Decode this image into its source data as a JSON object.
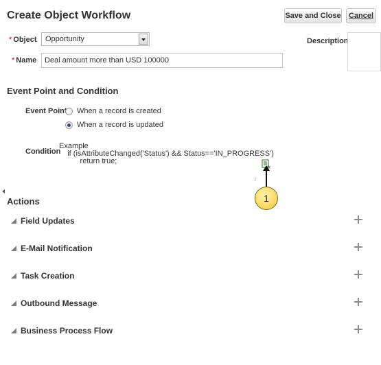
{
  "header": {
    "title": "Create Object Workflow",
    "save_close_label": "Save and Close",
    "cancel_label": "Cancel"
  },
  "form": {
    "required_marker": "*",
    "object_label": "Object",
    "object_value": "Opportunity",
    "name_label": "Name",
    "name_value": "Deal amount more than USD 100000",
    "description_label": "Description"
  },
  "event_section": {
    "title": "Event Point and Condition",
    "event_point_label": "Event Point",
    "options": [
      {
        "label": "When a record is created",
        "selected": false
      },
      {
        "label": "When a record is updated",
        "selected": true
      }
    ],
    "condition_label": "Condition",
    "condition_lines": [
      "Example",
      "    if (isAttributeChanged('Status') && Status=='IN_PROGRESS')",
      "          return true;"
    ],
    "condition_icon": "expression-builder-icon",
    "callout_number": "1"
  },
  "actions": {
    "title": "Actions",
    "items": [
      {
        "label": "Field Updates"
      },
      {
        "label": "E-Mail Notification"
      },
      {
        "label": "Task Creation"
      },
      {
        "label": "Outbound Message"
      },
      {
        "label": "Business Process Flow"
      }
    ]
  }
}
